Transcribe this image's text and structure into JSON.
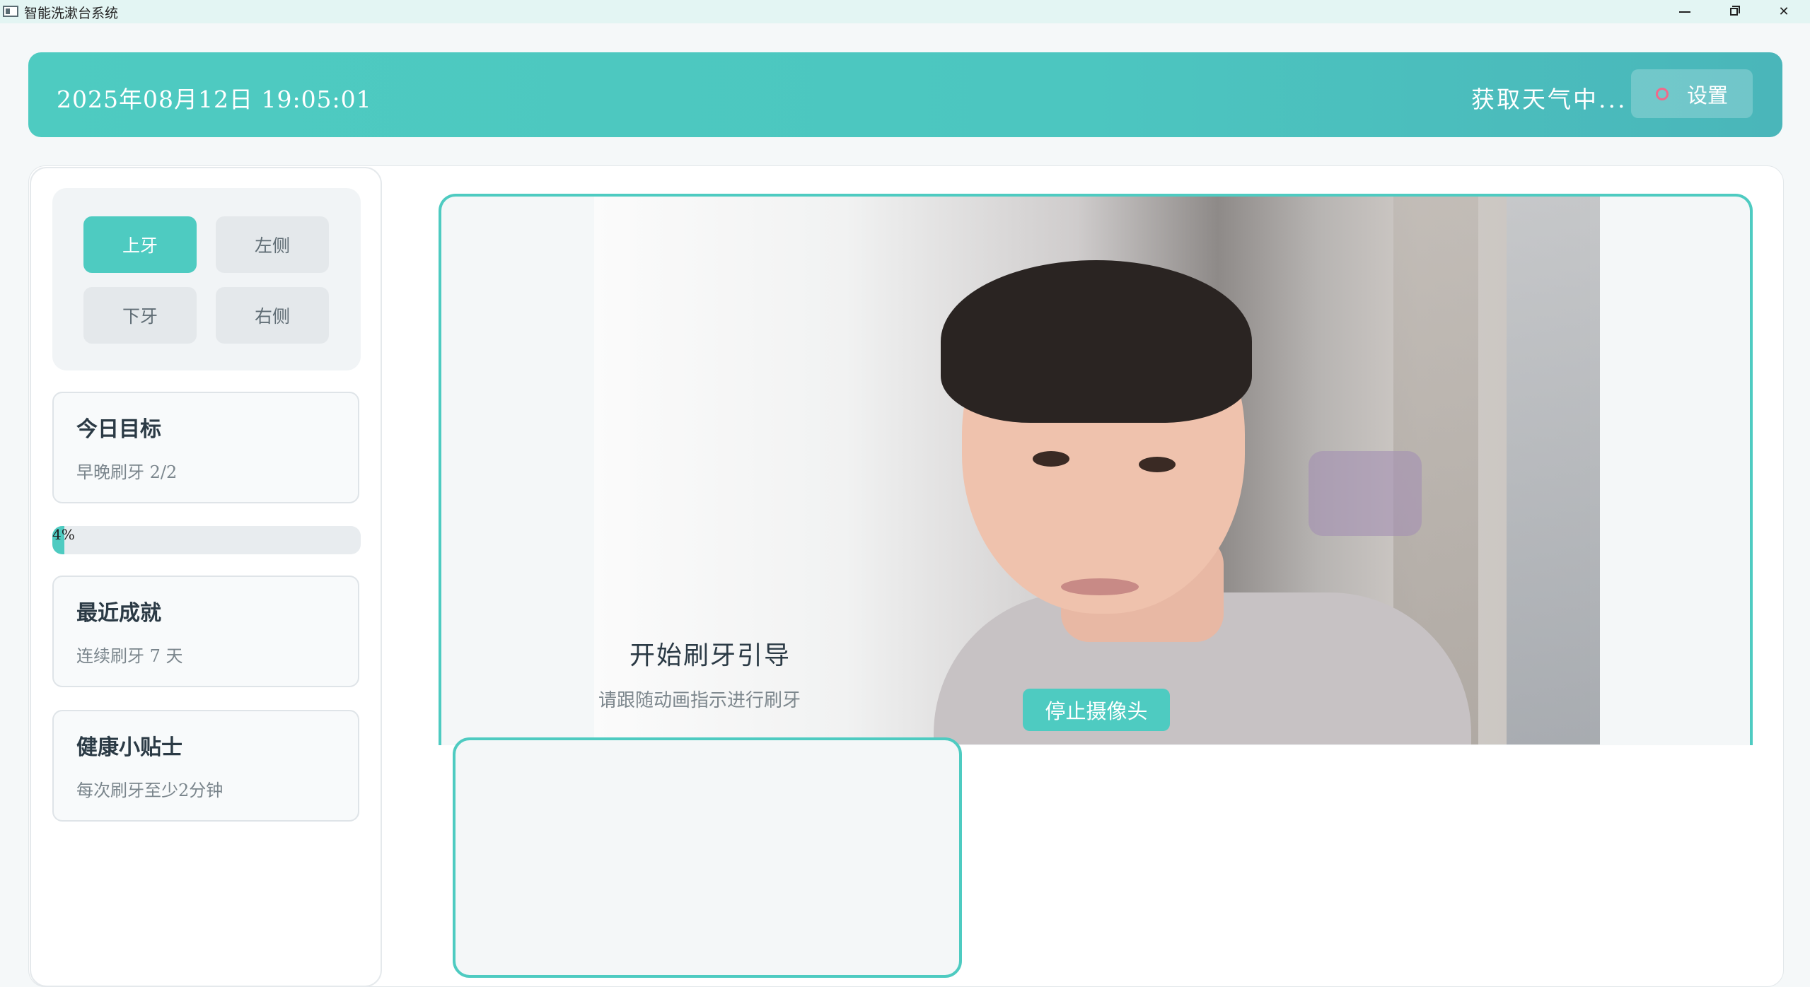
{
  "window": {
    "title": "智能洗漱台系统",
    "controls": [
      "minimize",
      "restore",
      "close"
    ]
  },
  "header": {
    "datetime": "2025年08月12日  19:05:01",
    "weather": "获取天气中...",
    "settings_label": "设置",
    "settings_icon": "gear-icon"
  },
  "sidebar": {
    "teeth_buttons": [
      {
        "label": "上牙",
        "active": true
      },
      {
        "label": "左侧",
        "active": false
      },
      {
        "label": "下牙",
        "active": false
      },
      {
        "label": "右侧",
        "active": false
      }
    ],
    "goal_card": {
      "title": "今日目标",
      "subtitle": "早晚刷牙 2/2"
    },
    "progress": {
      "value": 0.04,
      "text": "4%"
    },
    "achievement_card": {
      "title": "最近成就",
      "subtitle": "连续刷牙 7 天"
    },
    "tip_card": {
      "title": "健康小贴士",
      "subtitle": "每次刷牙至少2分钟"
    }
  },
  "main": {
    "guide_title": "开始刷牙引导",
    "guide_subtitle": "请跟随动画指示进行刷牙",
    "stop_camera_label": "停止摄像头"
  },
  "colors": {
    "accent": "#4ecbc1",
    "header_gradient_start": "#4ecbc1",
    "header_gradient_end": "#4ab6ba",
    "settings_icon": "#f06a8a"
  }
}
